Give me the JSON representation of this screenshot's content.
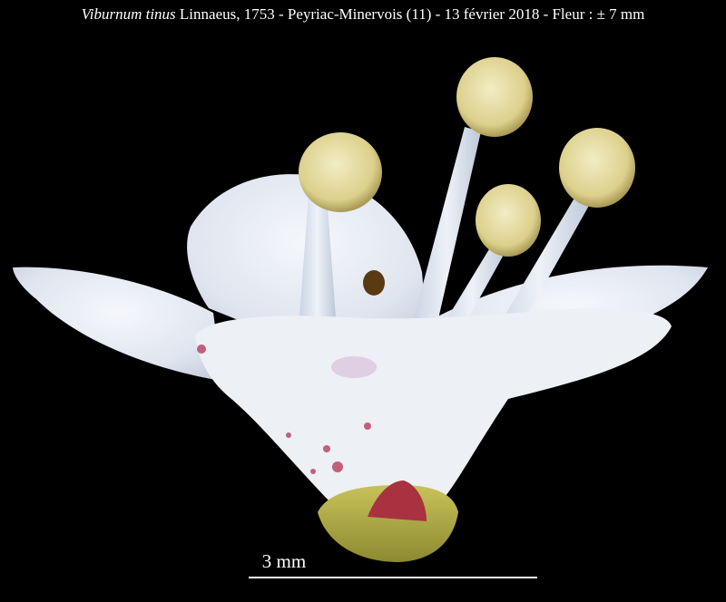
{
  "caption": {
    "species": "Viburnum tinus",
    "details": "Linnaeus, 1753 - Peyriac-Minervois (11) - 13 février 2018 - Fleur : ± 7 mm"
  },
  "scale_bar": {
    "label": "3 mm"
  },
  "colors": {
    "background": "#000000",
    "petal": "#e9edf4",
    "anther": "#e6dca0",
    "calyx": "#b9b44a",
    "stain": "#b23050"
  }
}
